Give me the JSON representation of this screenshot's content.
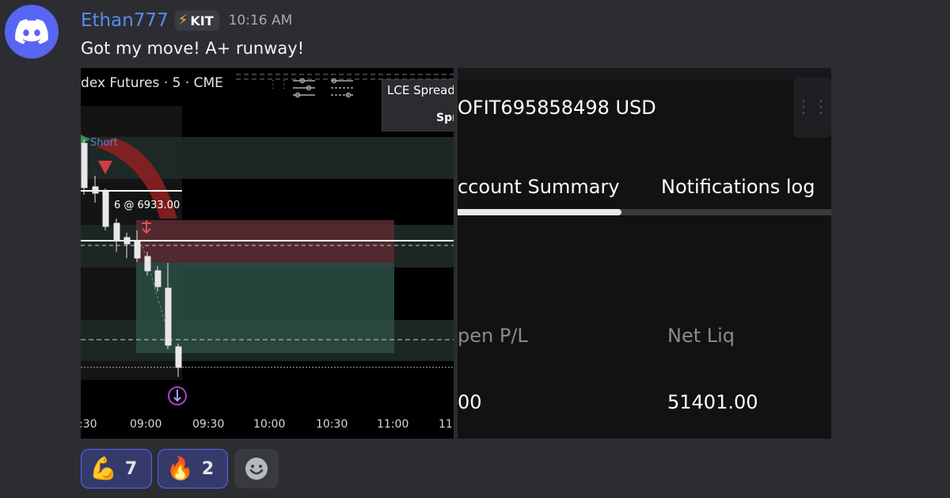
{
  "message": {
    "username": "Ethan777",
    "badge": {
      "icon": "lightning-icon",
      "label": "KIT"
    },
    "timestamp": "10:16 AM",
    "text": "Got my move! A+ runway!"
  },
  "chart_image": {
    "title": "dex Futures · 5 · CME",
    "spread_box": {
      "line1": "LCE Spread",
      "line2": "Spr"
    },
    "short_label": "Short",
    "fill_label": "6 @ 6933.00",
    "time_ticks": [
      ":30",
      "09:00",
      "09:30",
      "10:00",
      "10:30",
      "11:00",
      "11"
    ]
  },
  "account_panel": {
    "account_id": "OFIT695858498 USD",
    "tabs": [
      {
        "label": "ccount Summary",
        "active": true
      },
      {
        "label": "Notifications log",
        "active": false
      }
    ],
    "fields": [
      {
        "label": "pen P/L",
        "value": "00"
      },
      {
        "label": "Net Liq",
        "value": "51401.00"
      }
    ]
  },
  "reactions": [
    {
      "emoji": "💪",
      "icon": "flexed-biceps-icon",
      "count": "7"
    },
    {
      "emoji": "🔥",
      "icon": "fire-icon",
      "count": "2"
    }
  ],
  "colors": {
    "background": "#2b2d31",
    "username": "#5b8cf0",
    "reaction_border": "#5865f2",
    "discord_blurple": "#5865f2"
  }
}
